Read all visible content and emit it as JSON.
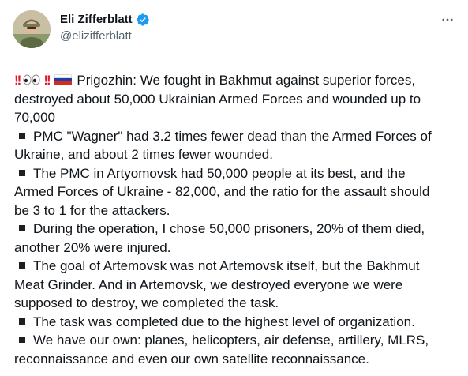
{
  "author": {
    "name": "Eli Zifferblatt",
    "handle": "@elizifferblatt",
    "verified": true
  },
  "icons": {
    "more": "more-horizontal-icon",
    "verified": "verified-badge-icon",
    "avatar": "profile-photo"
  },
  "colors": {
    "text": "#0f1419",
    "secondary": "#536471",
    "verified_blue": "#1d9bf0",
    "bang_red": "#e0192f"
  },
  "tweet": {
    "emoji_prefix": [
      "‼️",
      "👀",
      "‼️",
      "🇷🇺"
    ],
    "lines": [
      "Prigozhin: We fought in Bakhmut against superior forces,",
      "destroyed about 50,000 Ukrainian Armed Forces and wounded up to",
      "70,000",
      "PMC \"Wagner\" had 3.2 times fewer dead than the Armed Forces of",
      "Ukraine, and about 2 times fewer wounded.",
      "The PMC in Artyomovsk had 50,000 people at its best, and the",
      "Armed Forces of Ukraine - 82,000, and the ratio for the assault should",
      "be 3 to 1 for the attackers.",
      "During the operation, I chose 50,000 prisoners, 20% of them died,",
      "another 20% were injured.",
      "The goal of Artemovsk was not Artemovsk itself, but the Bakhmut",
      "Meat Grinder. And in Artemovsk, we destroyed everyone we were",
      "supposed to destroy, we completed the task.",
      "The task was completed due to the highest level of organization.",
      "We have our own: planes, helicopters, air defense, artillery, MLRS,",
      "reconnaissance and even our own satellite reconnaissance."
    ]
  }
}
